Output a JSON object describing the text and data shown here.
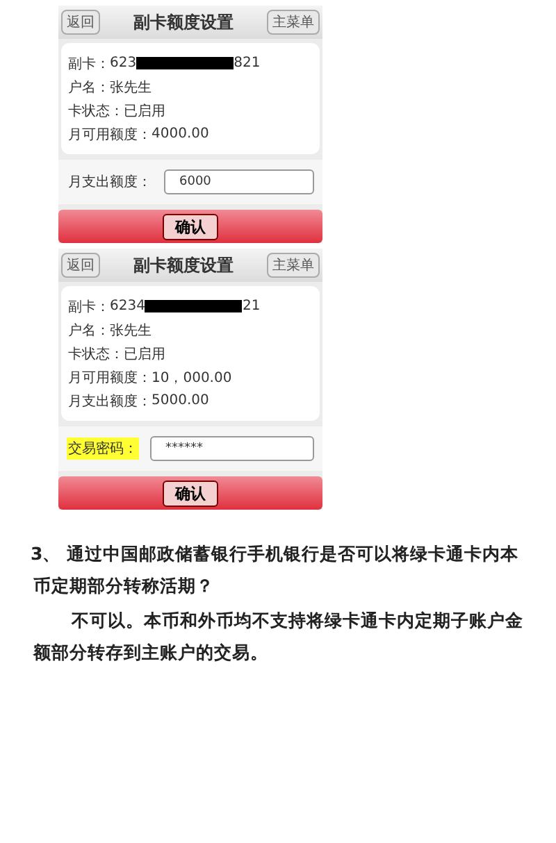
{
  "screens": [
    {
      "back": "返回",
      "title": "副卡额度设置",
      "menu": "主菜单",
      "card": {
        "label": "副卡：",
        "prefix": "623",
        "suffix": "821"
      },
      "info": [
        {
          "label": "户名：",
          "value": "张先生"
        },
        {
          "label": "卡状态：",
          "value": "已启用"
        },
        {
          "label": "月可用额度：",
          "value": "4000.00"
        }
      ],
      "field": {
        "label": "月支出额度：",
        "value": "6000",
        "highlight": false
      },
      "confirm": "确认"
    },
    {
      "back": "返回",
      "title": "副卡额度设置",
      "menu": "主菜单",
      "card": {
        "label": "副卡：",
        "prefix": "6234",
        "suffix": "21"
      },
      "info": [
        {
          "label": "户名：",
          "value": "张先生"
        },
        {
          "label": "卡状态：",
          "value": "已启用"
        },
        {
          "label": "月可用额度：",
          "value": "10，000.00"
        },
        {
          "label": "月支出额度：",
          "value": "5000.00"
        }
      ],
      "field": {
        "label": "交易密码：",
        "value": "******",
        "highlight": true
      },
      "confirm": "确认"
    }
  ],
  "question": "3、 通过中国邮政储蓄银行手机银行是否可以将绿卡通卡内本币定期部分转称活期？",
  "answer": "不可以。本币和外币均不支持将绿卡通卡内定期子账户金额部分转存到主账户的交易。"
}
